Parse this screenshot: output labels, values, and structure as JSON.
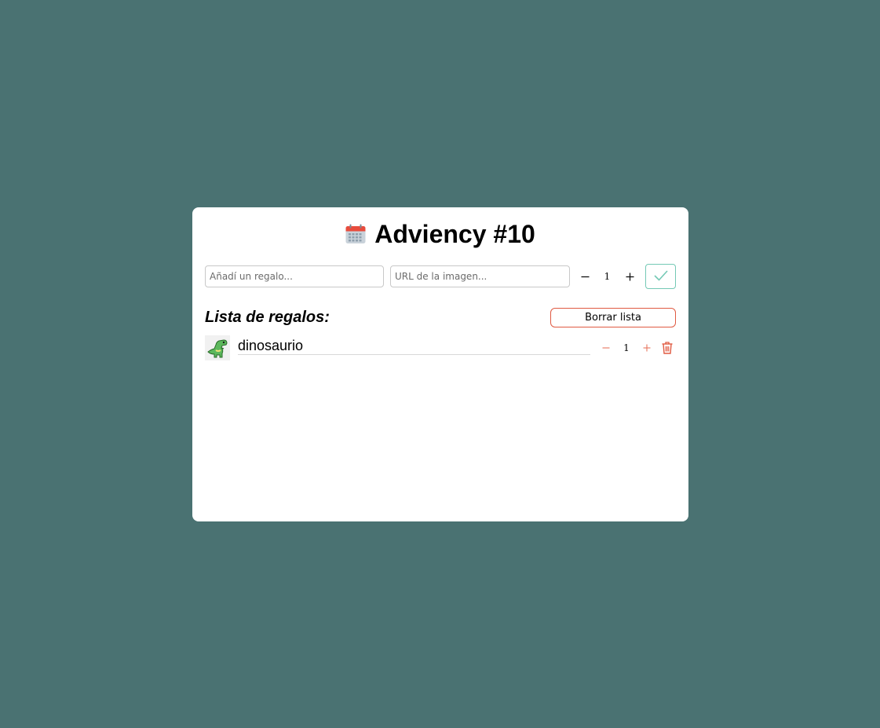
{
  "header": {
    "icon": "calendar-icon",
    "title": "Adviency #10"
  },
  "form": {
    "name_placeholder": "Añadí un regalo...",
    "url_placeholder": "URL de la imagen...",
    "quantity": "1",
    "confirm_icon": "checkmark-icon"
  },
  "list": {
    "title": "Lista de regalos:",
    "clear_label": "Borrar lista",
    "items": [
      {
        "name": "dinosaurio",
        "quantity": "1",
        "image_icon": "dinosaur-icon"
      }
    ]
  },
  "colors": {
    "background": "#4a7272",
    "card": "#ffffff",
    "accent_green": "#74c9b5",
    "accent_red": "#e05a42"
  }
}
